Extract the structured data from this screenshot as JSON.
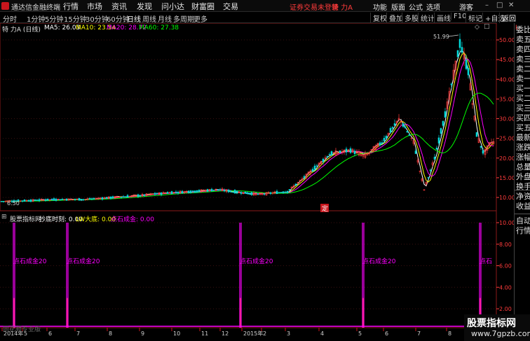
{
  "menubar": {
    "app_title": "通达信金融终端",
    "menus": [
      "行情",
      "市场",
      "资讯",
      "发现",
      "问小达",
      "财富圈",
      "交易"
    ],
    "warning": "证券交易未登录",
    "stock_name": "特 力A",
    "right_menus": [
      "功能",
      "版面",
      "公式",
      "选项",
      "游客"
    ],
    "brand_color": "#c8161d",
    "warning_color": "#ff3b3b"
  },
  "periods": [
    "分时",
    "1分钟",
    "5分钟",
    "15分钟",
    "30分钟",
    "60分钟",
    "日线",
    "周线",
    "月线",
    "多周期",
    "更多"
  ],
  "active_period": "日线",
  "tools": [
    "复权",
    "叠加",
    "多股",
    "统计",
    "画线",
    "F10",
    "标记",
    "+自选",
    "返回"
  ],
  "main_legend": {
    "title": "特 力A (日线)",
    "items": [
      {
        "label": "MA5: 26.03",
        "color": "#ffffff"
      },
      {
        "label": "MA10: 23.54",
        "color": "#ffff00"
      },
      {
        "label": "MA20: 28.72",
        "color": "#ff00ff"
      },
      {
        "label": "MA60: 27.38",
        "color": "#00ff00"
      }
    ]
  },
  "price_axis": [
    "50.00",
    "45.00",
    "40.00",
    "35.00",
    "30.00",
    "25.00",
    "20.00",
    "15.00",
    "10.00"
  ],
  "price_axis_color": "#ff3b3b",
  "high_marker": "51.99",
  "low_marker": "6.50",
  "ding_marker": "定",
  "indicator_legend": {
    "title": "股票指标网",
    "items": [
      {
        "label": "抄底时刻: 0.00",
        "color": "#ffffff"
      },
      {
        "label": "LW大底: 0.00",
        "color": "#ffff00"
      },
      {
        "label": "点石成金: 0.00",
        "color": "#ff00ff"
      }
    ]
  },
  "indicator_axis": [
    "10.00",
    "8.00",
    "6.00",
    "4.00",
    "2.00"
  ],
  "signal_label": "点石成金20",
  "signal_label_short": "点石",
  "date_axis": [
    "2014年",
    "5",
    "6",
    "7",
    "8",
    "9",
    "10",
    "11",
    "12",
    "2015年",
    "2",
    "3",
    "4",
    "5",
    "6",
    "7",
    "8"
  ],
  "right_rail": {
    "quote_rows": [
      "委比",
      "卖五",
      "卖四",
      "卖三",
      "卖二",
      "卖一",
      "买一",
      "买二",
      "买三",
      "买四",
      "买五",
      "最新",
      "涨跌",
      "涨幅",
      "总量",
      "外盘",
      "换手",
      "净资",
      "收益"
    ],
    "bottom": [
      "自动",
      "行情"
    ]
  },
  "watermark": {
    "line1": "股票指标网",
    "line2": "www.7gpzb.com"
  },
  "source_caption": "同花顺专业版",
  "colors": {
    "up": "#ff3b3b",
    "down": "#00d8d8",
    "ma5": "#ffffff",
    "ma10": "#ffff00",
    "ma20": "#ff00ff",
    "ma60": "#00ff00",
    "signal": "#ff00ff"
  }
}
